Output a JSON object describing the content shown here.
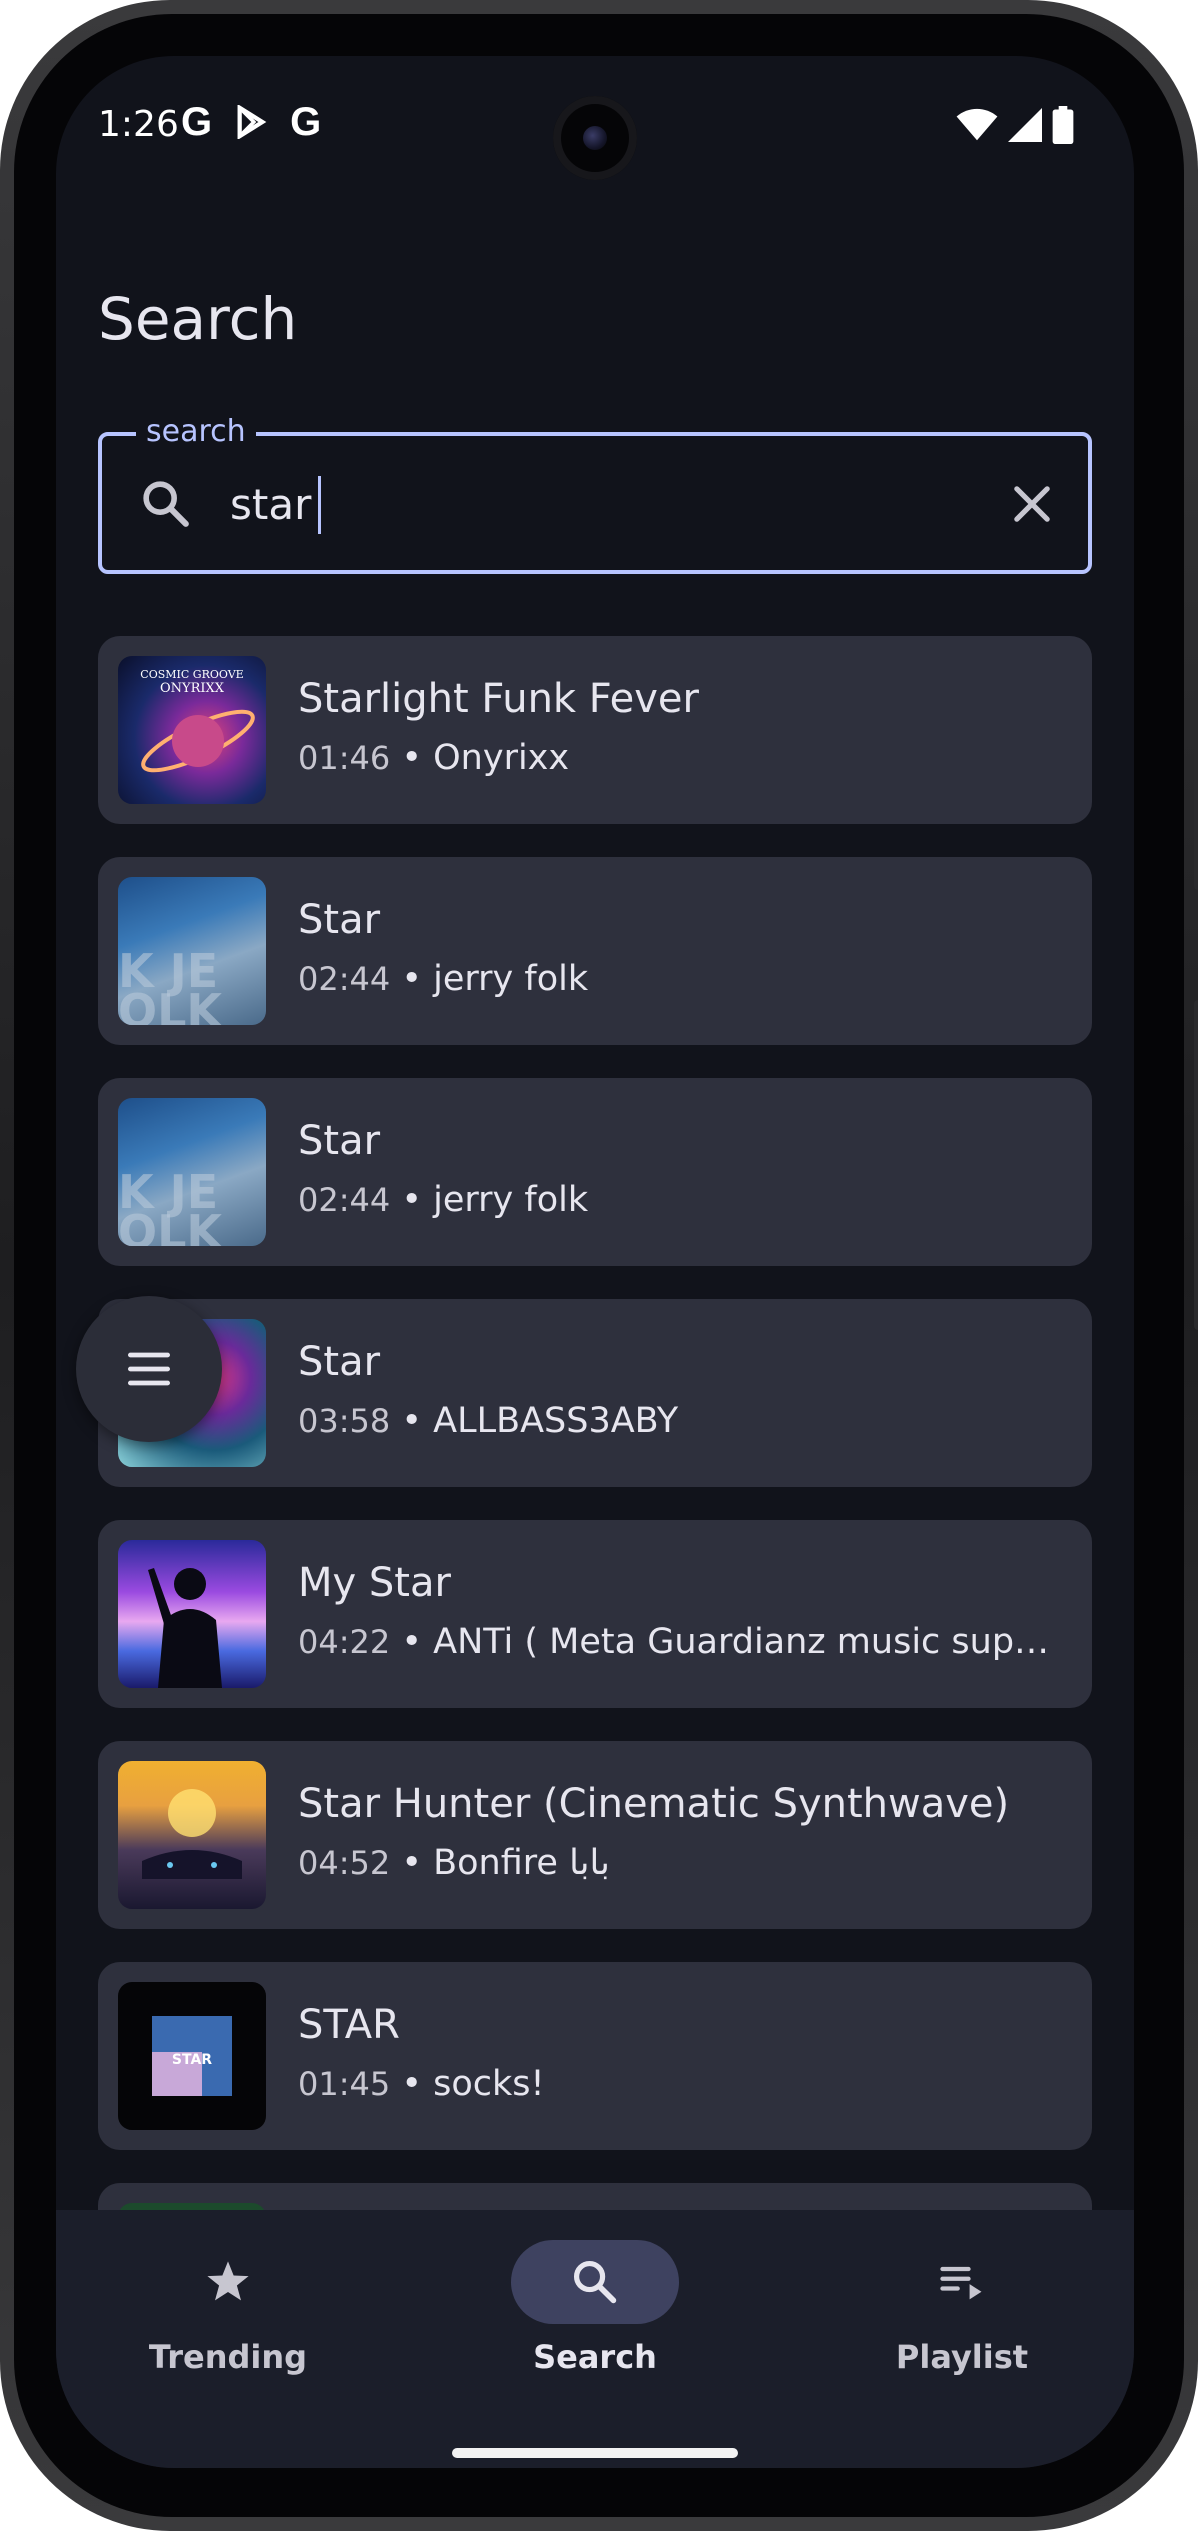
{
  "status_bar": {
    "time": "1:26",
    "left_icons": [
      "google-icon",
      "play-store-icon",
      "google-icon"
    ],
    "right_icons": [
      "wifi-icon",
      "signal-icon",
      "battery-icon"
    ]
  },
  "header": {
    "title": "Search"
  },
  "search": {
    "label": "search",
    "value": "star",
    "accent_color": "#b7c4ff"
  },
  "results": [
    {
      "title": "Starlight Funk Fever",
      "duration": "01:46",
      "artist": "Onyrixx",
      "thumb_icon": "album-art-cosmic"
    },
    {
      "title": "Star",
      "duration": "02:44",
      "artist": "jerry folk",
      "thumb_icon": "album-art-blue"
    },
    {
      "title": "Star",
      "duration": "02:44",
      "artist": "jerry folk",
      "thumb_icon": "album-art-blue"
    },
    {
      "title": "Star",
      "duration": "03:58",
      "artist": "ALLBASS3ABY",
      "thumb_icon": "album-art-nebula"
    },
    {
      "title": "My Star",
      "duration": "04:22",
      "artist": "ANTi ( Meta Guardianz music supervi…",
      "thumb_icon": "album-art-neon"
    },
    {
      "title": "Star Hunter (Cinematic Synthwave)",
      "duration": "04:52",
      "artist": "Bonfire بابا",
      "thumb_icon": "album-art-sunset"
    },
    {
      "title": "STAR",
      "duration": "01:45",
      "artist": "socks!",
      "thumb_icon": "album-art-star"
    }
  ],
  "bottom_nav": {
    "items": [
      {
        "label": "Trending",
        "icon": "star-icon",
        "active": false
      },
      {
        "label": "Search",
        "icon": "search-icon",
        "active": true
      },
      {
        "label": "Playlist",
        "icon": "playlist-icon",
        "active": false
      }
    ]
  },
  "colors": {
    "background": "#11131b",
    "card": "#2e303d",
    "nav_background": "#1b1e2a",
    "active_pill": "#3e4260"
  }
}
